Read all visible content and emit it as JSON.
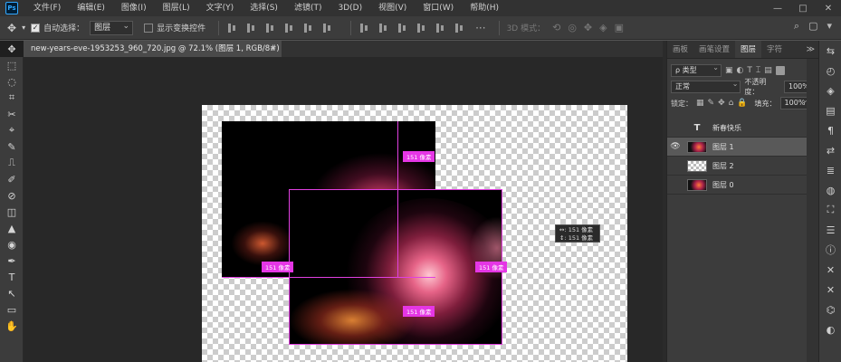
{
  "app": {
    "logo_text": "Ps"
  },
  "menu": [
    "文件(F)",
    "编辑(E)",
    "图像(I)",
    "图层(L)",
    "文字(Y)",
    "选择(S)",
    "滤镜(T)",
    "3D(D)",
    "视图(V)",
    "窗口(W)",
    "帮助(H)"
  ],
  "window_controls": [
    "—",
    "□",
    "✕"
  ],
  "options": {
    "auto_select_label": "自动选择：",
    "auto_select_checked": true,
    "auto_select_value": "图层",
    "transform_label": "显示变换控件",
    "transform_checked": false,
    "mode3d_label": "3D 模式：",
    "right_icons": [
      "⌕",
      "▢",
      "▾"
    ]
  },
  "document": {
    "tab_title": "new-years-eve-1953253_960_720.jpg @ 72.1% (图层 1, RGB/8#) *",
    "close": "×"
  },
  "tools": [
    "✥",
    "⬚",
    "◌",
    "⌗",
    "✂",
    "⌖",
    "✎",
    "⎍",
    "✐",
    "⊘",
    "◫",
    "▲",
    "◉",
    "✒",
    "T",
    "↖",
    "▭",
    "✋"
  ],
  "measure_labels": {
    "top": "151 像素",
    "left": "151 像素",
    "right": "151 像素",
    "bottom": "151 像素"
  },
  "tooltip": {
    "line1": "↔: 151 像素",
    "line2": "↕: 151 像素"
  },
  "panel": {
    "tabs": [
      "画板",
      "画笔设置",
      "图层",
      "字符"
    ],
    "active_tab": 2,
    "collapse": "≫",
    "menu": "≡",
    "kind_label": "ρ 类型",
    "filter_icons": [
      "▣",
      "◐",
      "T",
      "⌶",
      "▤"
    ],
    "blend_mode": "正常",
    "opacity_label": "不透明度：",
    "opacity_value": "100%",
    "lock_label": "锁定：",
    "lock_icons": [
      "▦",
      "✎",
      "✥",
      "⌂",
      "🔒"
    ],
    "fill_label": "填充：",
    "fill_value": "100%",
    "layers": [
      {
        "name": "新春快乐",
        "visible": false,
        "thumb": "text",
        "thumb_text": "T",
        "selected": false
      },
      {
        "name": "图层 1",
        "visible": true,
        "thumb": "fire",
        "selected": true
      },
      {
        "name": "图层 2",
        "visible": false,
        "thumb": "checker",
        "selected": false
      },
      {
        "name": "图层 0",
        "visible": false,
        "thumb": "fire",
        "selected": false
      }
    ],
    "eye_icon": "👁"
  },
  "right_strip_icons": [
    "⇆",
    "◴",
    "◈",
    "▤",
    "¶",
    "⇄",
    "≣",
    "◍",
    "⛶",
    "☰",
    "ⓘ",
    "✕",
    "✕",
    "⌬",
    "◐"
  ]
}
